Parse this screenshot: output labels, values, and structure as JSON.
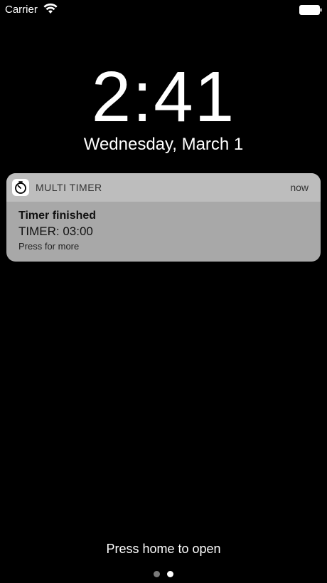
{
  "status_bar": {
    "carrier": "Carrier",
    "wifi_icon": "wifi-icon",
    "battery_icon": "battery-full-icon"
  },
  "lock_screen": {
    "time": "2:41",
    "date": "Wednesday, March 1"
  },
  "notification": {
    "app_icon": "stopwatch-icon",
    "app_name": "MULTI TIMER",
    "time": "now",
    "title": "Timer finished",
    "body": "TIMER: 03:00",
    "hint": "Press for more"
  },
  "footer": {
    "home_hint": "Press home to open",
    "page_dots": {
      "count": 2,
      "active": 2
    }
  },
  "colors": {
    "background": "#000000",
    "notification_bg": "#a8a8a8",
    "notification_header_bg": "#bdbdbd",
    "text": "#ffffff"
  }
}
